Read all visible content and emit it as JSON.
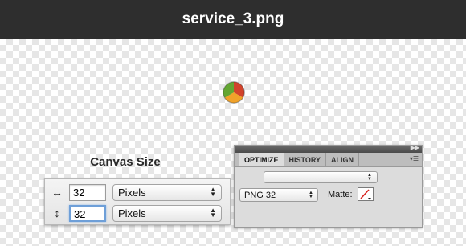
{
  "window": {
    "title": "service_3.png"
  },
  "icons": {
    "sample": "pie-chart-icon",
    "width": "horizontal-arrow-icon",
    "height": "vertical-arrow-icon"
  },
  "canvas_size": {
    "title": "Canvas Size",
    "width_glyph": "↔",
    "height_glyph": "↕",
    "width_value": "32",
    "height_value": "32",
    "width_unit": "Pixels",
    "height_unit": "Pixels"
  },
  "optimize_panel": {
    "tabs": [
      "OPTIMIZE",
      "HISTORY",
      "ALIGN"
    ],
    "active_tab": "OPTIMIZE",
    "preset": "",
    "format": "PNG 32",
    "matte_label": "Matte:"
  },
  "colors": {
    "titlebar": "#2e2e2e",
    "pie_red": "#d2432b",
    "pie_orange": "#f0a22a",
    "pie_green": "#63a632",
    "focus_ring": "#6e9fd8"
  }
}
